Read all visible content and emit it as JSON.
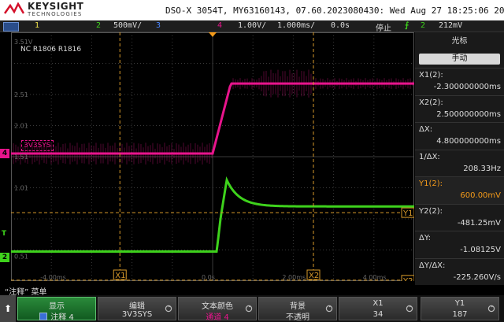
{
  "header": {
    "brand": "KEYSIGHT",
    "brand_sub": "TECHNOLOGIES",
    "model_line": "DSO-X 3054T,  MY63160143, 07.60.2023080430: Wed Aug 27 18:25:06 2025"
  },
  "channel_bar": {
    "ch1": "1",
    "ch2": "2",
    "ch2_scale": "500mV/",
    "ch3": "3",
    "ch4": "4",
    "ch4_scale": "1.00V/",
    "timebase": "1.000ms/",
    "delay": "0.0s",
    "run_state": "停止",
    "trig_ch": "2",
    "trig_level": "212mV"
  },
  "grid": {
    "annotation": "NC R1806 R1816",
    "label_3v3": "3V3SYS",
    "y_labels": [
      "3.51V",
      "2.51",
      "2.01",
      "1.51",
      "1.01",
      "0.51"
    ],
    "x_labels": [
      "-4.00ms",
      "0.0s",
      "2.00ms",
      "4.00ms"
    ],
    "x_marker1": "X1",
    "x_marker2": "X2",
    "y_marker1": "Y1",
    "y_marker2": "Y2",
    "ch_marker_4": "4",
    "ch_marker_2": "2",
    "trig_marker": "T",
    "colors": {
      "ch4": "#e8148c",
      "ch2": "#3ed21c",
      "cursor": "#d89a2a",
      "grid": "#3a3a3a"
    },
    "traces": {
      "ch4_low_div": 3.9,
      "ch4_high_div": 1.65,
      "ch4_rise_start_ms": 0.0,
      "ch4_rise_end_ms": 0.45,
      "ch2_low_div": 7.05,
      "ch2_high_div": 5.6,
      "ch2_step_ms": 0.1
    }
  },
  "right_panel": {
    "title": "光标",
    "mode_button": "手动",
    "rows": [
      {
        "label": "X1(2):",
        "value": "-2.300000000ms"
      },
      {
        "label": "X2(2):",
        "value": "2.500000000ms"
      },
      {
        "label": "ΔX:",
        "value": "4.800000000ms"
      },
      {
        "label": "1/ΔX:",
        "value": "208.33Hz"
      },
      {
        "label": "Y1(2):",
        "value": "600.00mV",
        "selected": true
      },
      {
        "label": "Y2(2):",
        "value": "-481.25mV"
      },
      {
        "label": "ΔY:",
        "value": "-1.08125V"
      },
      {
        "label": "ΔY/ΔX:",
        "value": "-225.260V/s"
      }
    ]
  },
  "menu": {
    "title": "“注释” 菜单",
    "back_icon": "back-arrow-icon",
    "keys": [
      {
        "top": "显示",
        "bottom": "注释 4",
        "active": true
      },
      {
        "top": "编辑",
        "bottom": "3V3SYS"
      },
      {
        "top": "文本颜色",
        "bottom": "通道 4",
        "bottom_color": "#e8148c"
      },
      {
        "top": "背景",
        "bottom": "不透明"
      },
      {
        "top": "X1",
        "bottom": "34"
      },
      {
        "top": "Y1",
        "bottom": "187"
      }
    ]
  }
}
